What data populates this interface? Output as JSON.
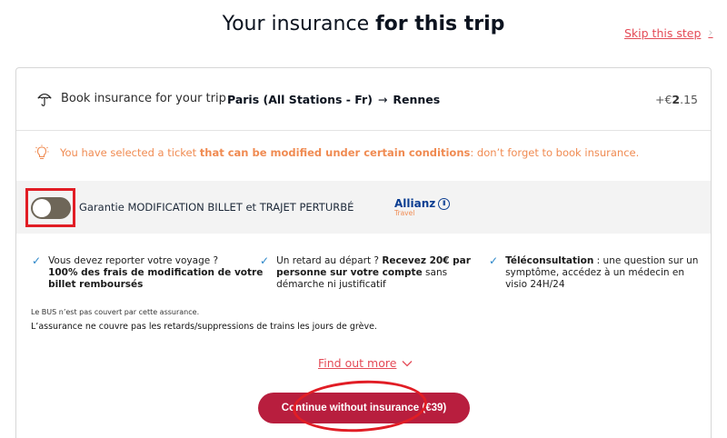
{
  "page": {
    "title_prefix": "Your insurance ",
    "title_bold": "for this trip",
    "skip_label": "Skip this step",
    "skip_chevron": "›"
  },
  "card": {
    "book_label": "Book insurance for your trip",
    "route_from": "Paris (All Stations - Fr)",
    "route_arrow": "→",
    "route_to": "Rennes",
    "price_prefix": "+€",
    "price_main": "2",
    "price_cents": ".15",
    "warning_start": "You have selected a ticket ",
    "warning_bold": "that can be modified under certain conditions",
    "warning_end": ": don’t forget to book insurance."
  },
  "product": {
    "toggle_state": "off",
    "name": "Garantie MODIFICATION BILLET et TRAJET PERTURBÉ",
    "brand": "Allianz",
    "brand_sub": "Travel",
    "brand_mark": "⦀"
  },
  "features": [
    {
      "line1": "Vous devez reporter votre voyage ?",
      "line2_bold": "100% des frais de modification de votre",
      "line3_bold": "billet remboursés"
    },
    {
      "line1_start": "Un retard au départ ? ",
      "line1_bold": "Recevez 20€ par",
      "line2_bold": "personne sur votre compte",
      "line2_end": " sans",
      "line3": "démarche ni justificatif"
    },
    {
      "line1_bold": "Téléconsultation",
      "line1_end": " : une question sur un",
      "line2": "symptôme, accédez à un médecin en",
      "line3": "visio 24H/24"
    }
  ],
  "notes": {
    "bus": "Le BUS n’est pas couvert par cette assurance.",
    "strikes": "L’assurance ne couvre pas les retards/suppressions de trains les jours de grève."
  },
  "actions": {
    "find_more": "Find out more",
    "continue_label": "Continue without insurance (€39)"
  },
  "colors": {
    "accent": "#e44b57",
    "button": "#b81e3e",
    "warning": "#f08b52",
    "annotation": "#e11d25"
  },
  "icons": {
    "umbrella": "umbrella-icon",
    "bulb": "lightbulb-icon",
    "check": "check-icon",
    "chevron": "chevron-down-icon"
  }
}
